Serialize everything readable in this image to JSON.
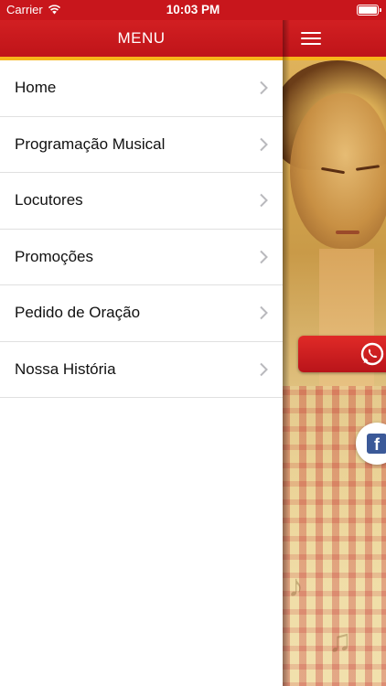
{
  "status_bar": {
    "carrier": "Carrier",
    "time": "10:03 PM"
  },
  "menu": {
    "title": "MENU",
    "items": [
      {
        "label": "Home"
      },
      {
        "label": "Programação Musical"
      },
      {
        "label": "Locutores"
      },
      {
        "label": "Promoções"
      },
      {
        "label": "Pedido de Oração"
      },
      {
        "label": "Nossa História"
      }
    ]
  },
  "content": {
    "social": {
      "whatsapp_icon": "whatsapp-icon",
      "facebook_icon": "facebook-icon",
      "facebook_glyph": "f"
    }
  },
  "colors": {
    "header_red": "#c8161c",
    "accent_yellow": "#f7b51b"
  }
}
